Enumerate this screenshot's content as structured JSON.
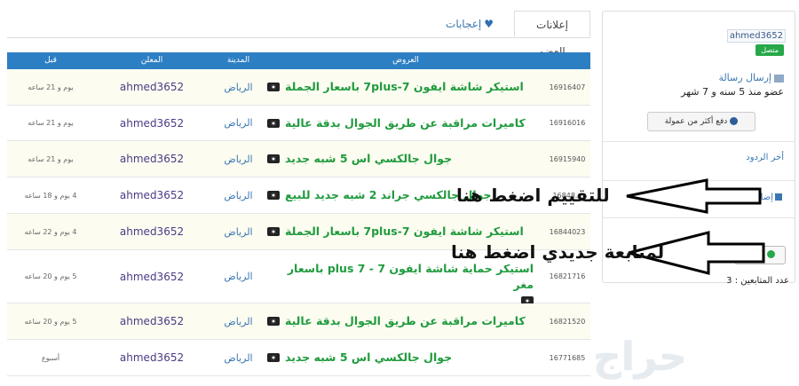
{
  "tabs": {
    "active": "إعلانات العضو",
    "other": "إعجابات"
  },
  "table": {
    "headers": {
      "offers": "العروض",
      "city": "المدينة",
      "advertiser": "المعلن",
      "before": "قبل"
    },
    "rows": [
      {
        "id": "16916407",
        "title": "استيكر شاشة ايفون 7plus-7 باسعار الجملة",
        "city": "الرياض",
        "user": "ahmed3652",
        "age": "يوم و 21 ساعه"
      },
      {
        "id": "16916016",
        "title": "كاميرات مراقبة عن طريق الجوال بدقة عالية",
        "city": "الرياض",
        "user": "ahmed3652",
        "age": "يوم و 21 ساعه"
      },
      {
        "id": "16915940",
        "title": "جوال جالكسي اس 5 شبه جديد",
        "city": "الرياض",
        "user": "ahmed3652",
        "age": "يوم و 21 ساعه"
      },
      {
        "id": "16848...",
        "title": "جوال جالكسي جراند 2 شبه جديد للبيع",
        "city": "الرياض",
        "user": "ahmed3652",
        "age": "4 يوم و 18 ساعه"
      },
      {
        "id": "16844023",
        "title": "استيكر شاشة ايفون 7plus-7 باسعار الجملة",
        "city": "الرياض",
        "user": "ahmed3652",
        "age": "4 يوم و 22 ساعه"
      },
      {
        "id": "16821716",
        "title": "استيكر حماية شاشة ايفون 7 - plus 7 باسعار مغر",
        "city": "الرياض",
        "user": "ahmed3652",
        "age": "5 يوم و 20 ساعه"
      },
      {
        "id": "16821520",
        "title": "كاميرات مراقبة عن طريق الجوال بدقة عالية",
        "city": "الرياض",
        "user": "ahmed3652",
        "age": "5 يوم و 20 ساعه"
      },
      {
        "id": "16771685",
        "title": "جوال جالكسي اس 5 شبه جديد",
        "city": "الرياض",
        "user": "ahmed3652",
        "age": "أسبوع"
      }
    ]
  },
  "sidebar": {
    "username": "ahmed3652",
    "badge": "متصل",
    "send_message": "إرسال رسالة",
    "member_since": "عضو منذ 5 سنه و 7 شهر",
    "pay_commission": "دفع أكثر من عمولة",
    "last_replies": "أخر الردود",
    "add_rating": "إضافة تقييم",
    "follow": "متابعة",
    "followers": "عدد المتابعين : 3"
  },
  "annotations": {
    "rate_hint": "للتقييم اضغط هنا",
    "follow_hint": "لمتابعة جديدي اضغط هنا"
  },
  "watermark": "حراج",
  "colors": {
    "header_blue": "#2d7fc4",
    "title_green": "#1f9b3d",
    "badge_green": "#27a84a",
    "link_blue": "#3a77b2"
  }
}
